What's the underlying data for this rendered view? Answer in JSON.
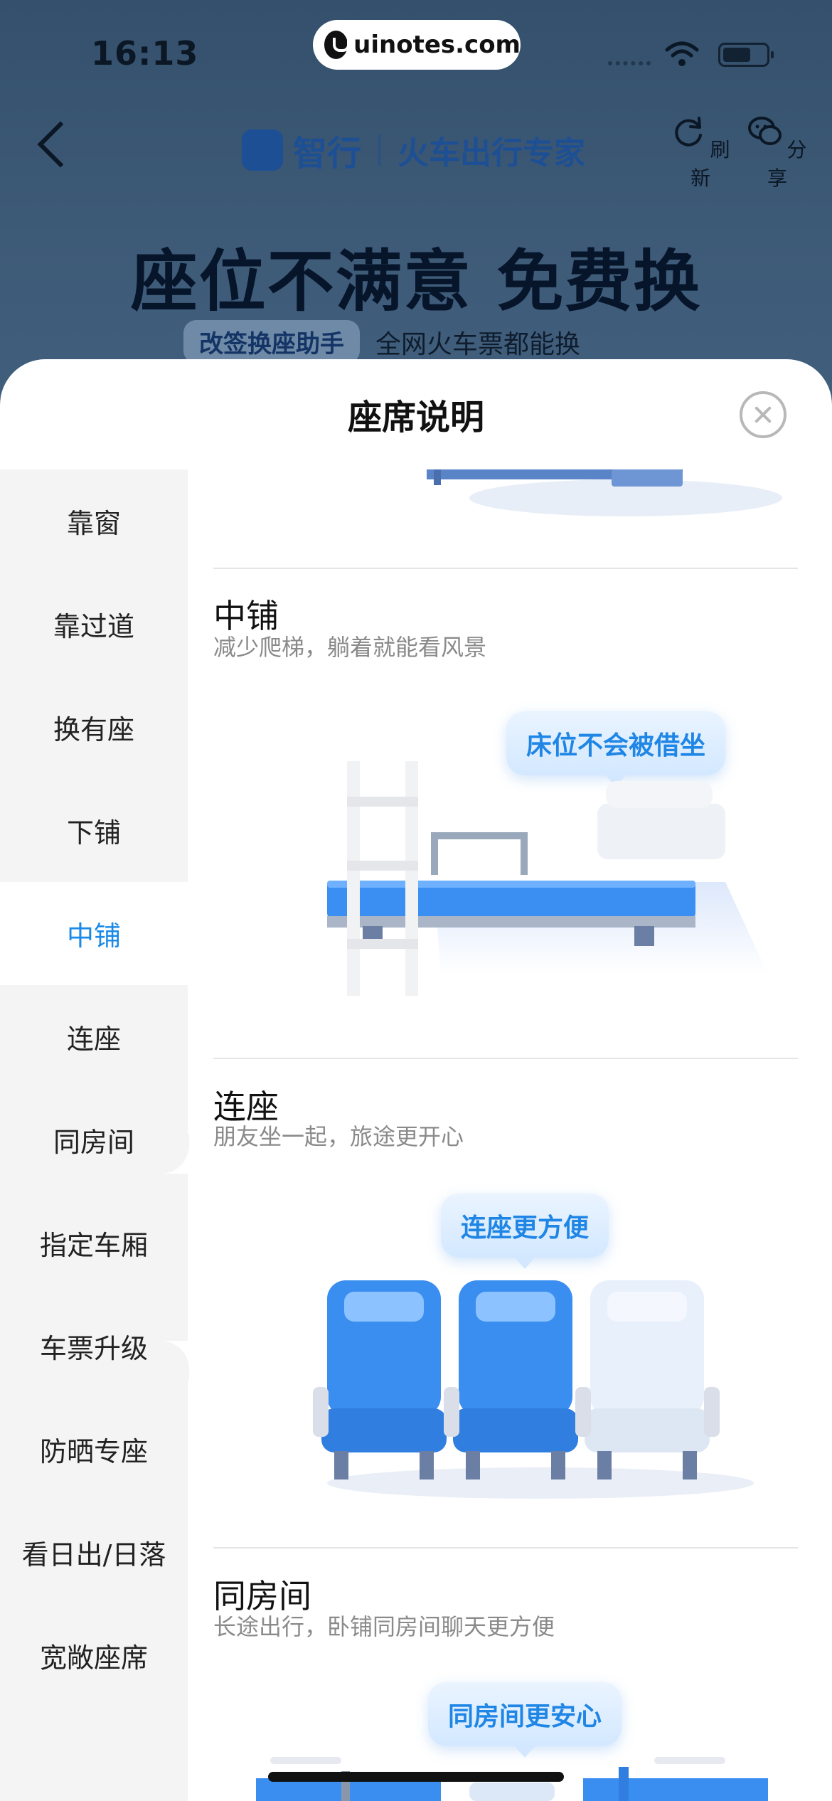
{
  "status_bar": {
    "time": "16:13",
    "url": "uinotes.com"
  },
  "header": {
    "brand_name": "智行",
    "brand_tagline": "火车出行专家",
    "refresh_label": "刷新",
    "share_label": "分享"
  },
  "banner": {
    "headline": "座位不满意 免费换",
    "chip": "改签换座助手",
    "subtext": "全网火车票都能换"
  },
  "sheet": {
    "title": "座席说明",
    "sidebar": [
      {
        "label": "靠窗"
      },
      {
        "label": "靠过道"
      },
      {
        "label": "换有座"
      },
      {
        "label": "下铺"
      },
      {
        "label": "中铺"
      },
      {
        "label": "连座"
      },
      {
        "label": "同房间"
      },
      {
        "label": "指定车厢"
      },
      {
        "label": "车票升级"
      },
      {
        "label": "防晒专座"
      },
      {
        "label": "看日出/日落"
      },
      {
        "label": "宽敞座席"
      }
    ],
    "active_item": "中铺",
    "sections": [
      {
        "title": "中铺",
        "desc": "减少爬梯，躺着就能看风景",
        "bubble": "床位不会被借坐"
      },
      {
        "title": "连座",
        "desc": "朋友坐一起，旅途更开心",
        "bubble": "连座更方便"
      },
      {
        "title": "同房间",
        "desc": "长途出行，卧铺同房间聊天更方便",
        "bubble": "同房间更安心"
      }
    ]
  },
  "colors": {
    "accent": "#1a8ae8",
    "seat_blue": "#3a8ef0",
    "sidebar_bg": "#f4f4f4"
  }
}
